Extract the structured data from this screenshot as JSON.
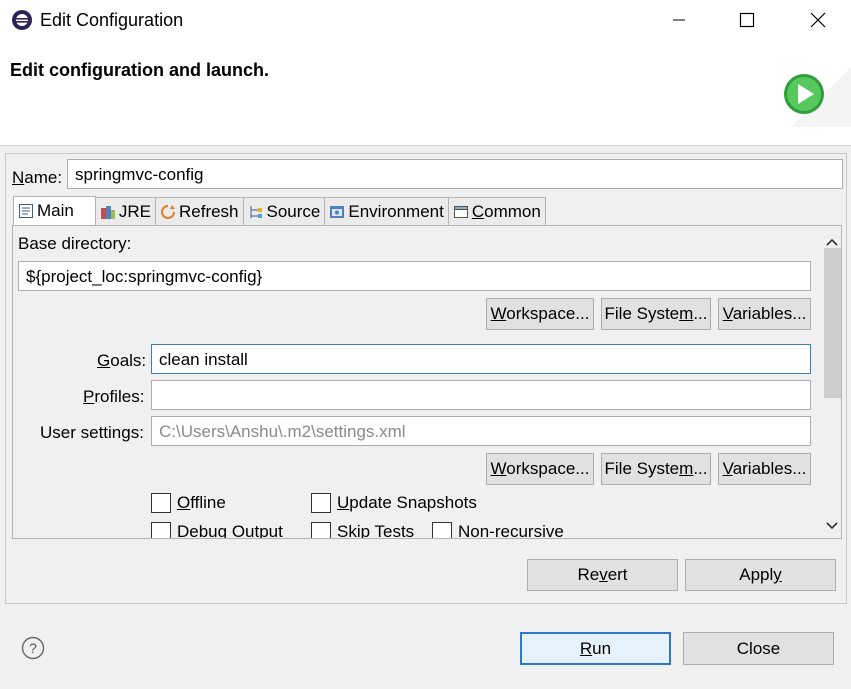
{
  "window": {
    "title": "Edit Configuration"
  },
  "header": {
    "title": "Edit configuration and launch."
  },
  "name_field": {
    "label": "Name:",
    "value": "springmvc-config"
  },
  "tabs": [
    {
      "label": "Main",
      "icon": "main-tab-icon",
      "active": true
    },
    {
      "label": "JRE",
      "icon": "jre-icon"
    },
    {
      "label": "Refresh",
      "icon": "refresh-icon"
    },
    {
      "label": "Source",
      "icon": "source-icon"
    },
    {
      "label": "Environment",
      "icon": "environment-icon"
    },
    {
      "label": "Common",
      "icon": "common-icon"
    }
  ],
  "main_tab": {
    "base_directory_label": "Base directory:",
    "base_directory_value": "${project_loc:springmvc-config}",
    "workspace_button": "Workspace...",
    "file_system_button": "File System...",
    "variables_button": "Variables...",
    "goals_label": "Goals:",
    "goals_value": "clean install",
    "profiles_label": "Profiles:",
    "profiles_value": "",
    "user_settings_label": "User settings:",
    "user_settings_value": "C:\\Users\\Anshu\\.m2\\settings.xml",
    "checkboxes": {
      "offline": "Offline",
      "update_snapshots": "Update Snapshots",
      "debug_output": "Debug Output",
      "skip_tests": "Skip Tests",
      "non_recursive": "Non-recursive"
    }
  },
  "panel_buttons": {
    "revert": "Revert",
    "apply": "Apply"
  },
  "footer": {
    "run": "Run",
    "close": "Close",
    "help_icon": "help-icon"
  },
  "colors": {
    "focus_border": "#3c7fb1",
    "default_button_border": "#2f78c8",
    "run_icon_green": "#3cb043"
  }
}
